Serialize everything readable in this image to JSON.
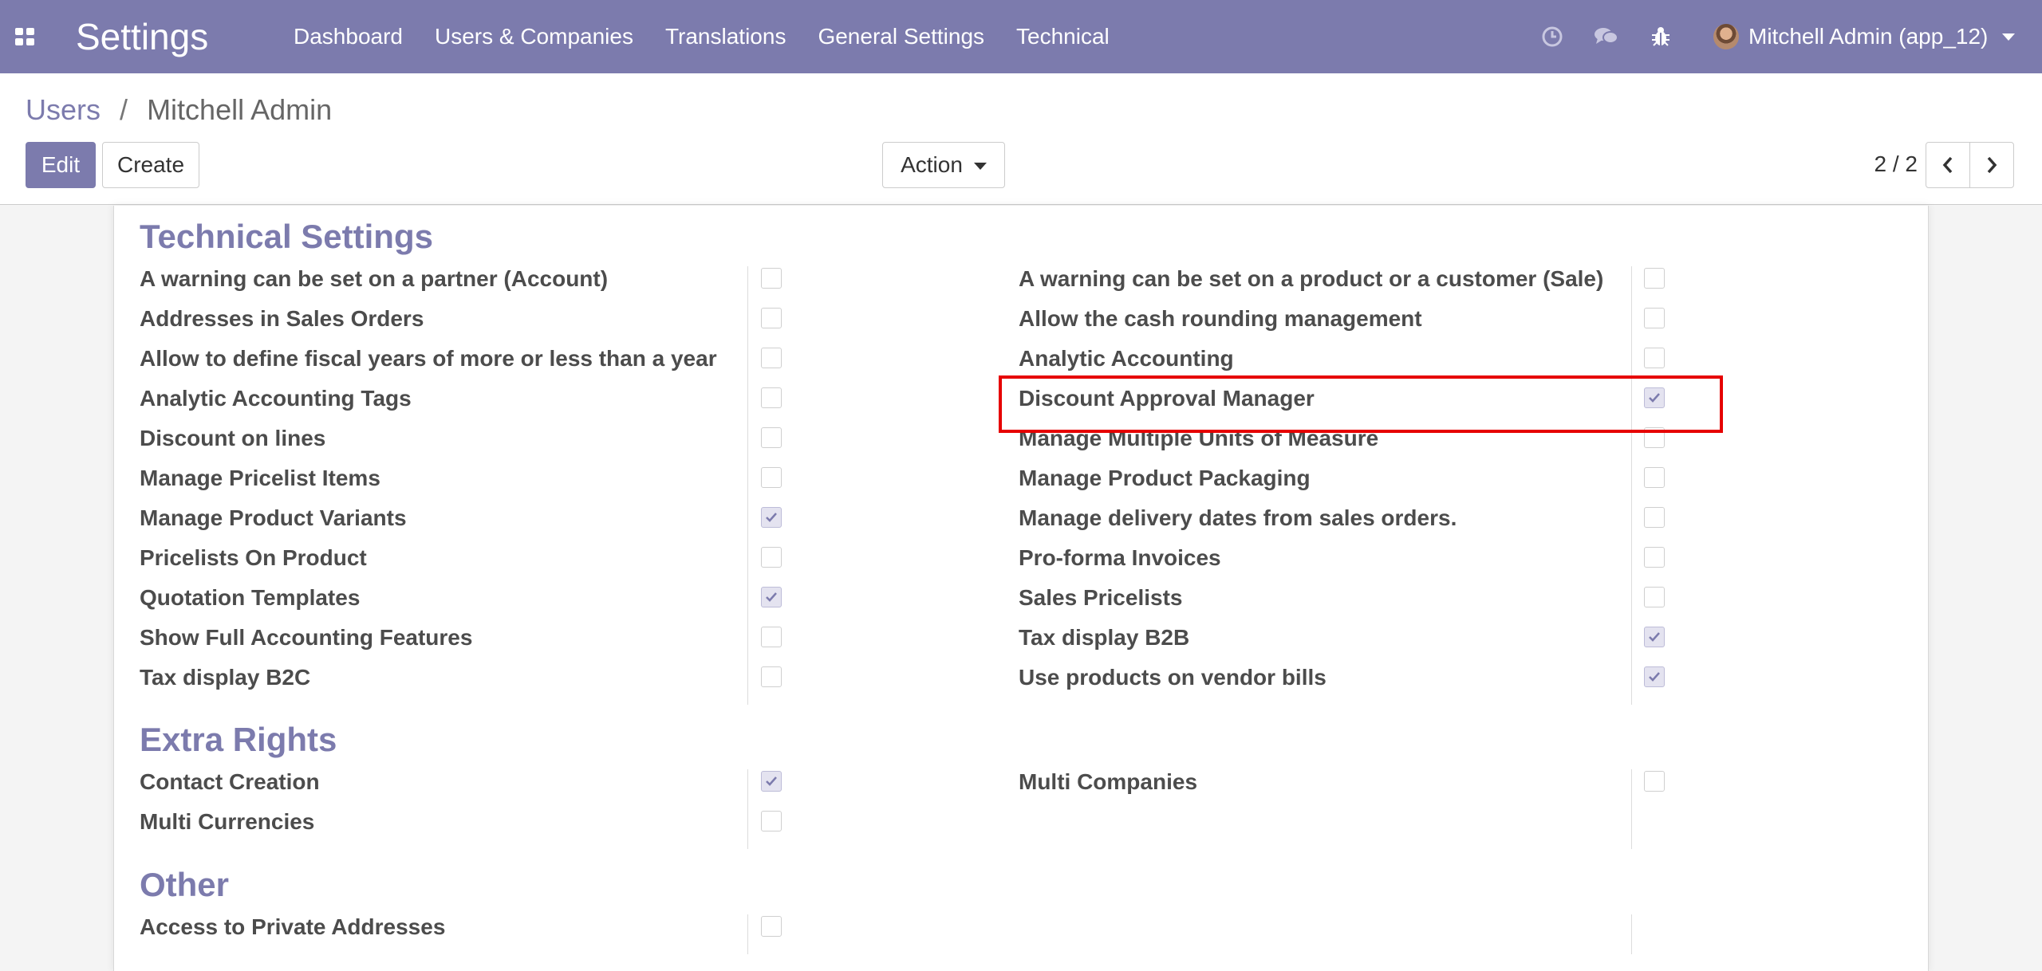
{
  "navbar": {
    "brand": "Settings",
    "menu": [
      "Dashboard",
      "Users & Companies",
      "Translations",
      "General Settings",
      "Technical"
    ],
    "icons": [
      "clock-icon",
      "chat-icon",
      "bug-icon"
    ],
    "user": "Mitchell Admin (app_12)"
  },
  "breadcrumb": {
    "parent": "Users",
    "separator": "/",
    "current": "Mitchell Admin"
  },
  "buttons": {
    "edit": "Edit",
    "create": "Create",
    "action": "Action"
  },
  "pager": {
    "value": "2 / 2"
  },
  "sections": {
    "technical": {
      "title": "Technical Settings",
      "left": [
        {
          "label": "A warning can be set on a partner (Account)",
          "checked": false
        },
        {
          "label": "Addresses in Sales Orders",
          "checked": false
        },
        {
          "label": "Allow to define fiscal years of more or less than a year",
          "checked": false
        },
        {
          "label": "Analytic Accounting Tags",
          "checked": false
        },
        {
          "label": "Discount on lines",
          "checked": false
        },
        {
          "label": "Manage Pricelist Items",
          "checked": false
        },
        {
          "label": "Manage Product Variants",
          "checked": true
        },
        {
          "label": "Pricelists On Product",
          "checked": false
        },
        {
          "label": "Quotation Templates",
          "checked": true
        },
        {
          "label": "Show Full Accounting Features",
          "checked": false
        },
        {
          "label": "Tax display B2C",
          "checked": false
        }
      ],
      "right": [
        {
          "label": "A warning can be set on a product or a customer (Sale)",
          "checked": false
        },
        {
          "label": "Allow the cash rounding management",
          "checked": false
        },
        {
          "label": "Analytic Accounting",
          "checked": false
        },
        {
          "label": "Discount Approval Manager",
          "checked": true
        },
        {
          "label": "Manage Multiple Units of Measure",
          "checked": false
        },
        {
          "label": "Manage Product Packaging",
          "checked": false
        },
        {
          "label": "Manage delivery dates from sales orders.",
          "checked": false
        },
        {
          "label": "Pro-forma Invoices",
          "checked": false
        },
        {
          "label": "Sales Pricelists",
          "checked": false
        },
        {
          "label": "Tax display B2B",
          "checked": true
        },
        {
          "label": "Use products on vendor bills",
          "checked": true
        }
      ]
    },
    "extra": {
      "title": "Extra Rights",
      "left": [
        {
          "label": "Contact Creation",
          "checked": true
        },
        {
          "label": "Multi Currencies",
          "checked": false
        }
      ],
      "right": [
        {
          "label": "Multi Companies",
          "checked": false
        }
      ]
    },
    "other": {
      "title": "Other",
      "left": [
        {
          "label": "Access to Private Addresses",
          "checked": false
        }
      ],
      "right": []
    }
  },
  "colors": {
    "brand": "#7c7bad",
    "highlight": "#e60000"
  }
}
